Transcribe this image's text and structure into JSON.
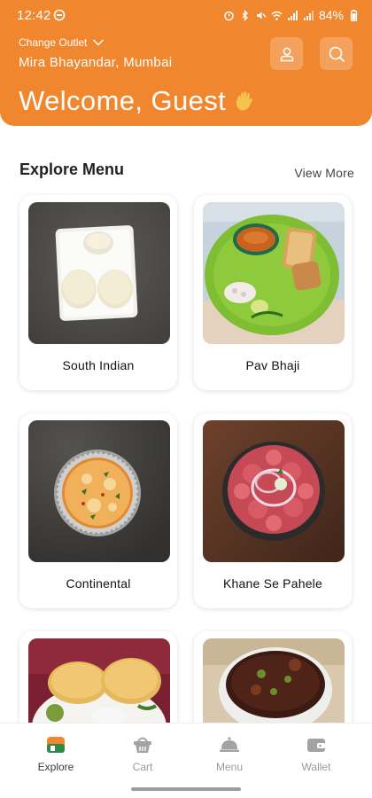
{
  "status_bar": {
    "time": "12:42",
    "battery": "84%"
  },
  "header": {
    "change_outlet_label": "Change Outlet",
    "outlet_name": "Mira Bhayandar, Mumbai",
    "welcome_text": "Welcome, Guest",
    "wave_icon": "waving-hand-icon",
    "profile_icon": "user-icon",
    "search_icon": "search-icon",
    "background_color": "#f0872f"
  },
  "explore": {
    "title": "Explore Menu",
    "view_more_label": "View More",
    "categories": [
      {
        "name": "South Indian"
      },
      {
        "name": "Pav Bhaji"
      },
      {
        "name": "Continental"
      },
      {
        "name": "Khane Se Pahele"
      },
      {
        "name": ""
      },
      {
        "name": ""
      }
    ]
  },
  "bottom_nav": {
    "items": [
      {
        "label": "Explore",
        "icon": "explore-store-icon",
        "active": true
      },
      {
        "label": "Cart",
        "icon": "cart-basket-icon",
        "active": false
      },
      {
        "label": "Menu",
        "icon": "cloche-icon",
        "active": false
      },
      {
        "label": "Wallet",
        "icon": "wallet-icon",
        "active": false
      }
    ]
  }
}
